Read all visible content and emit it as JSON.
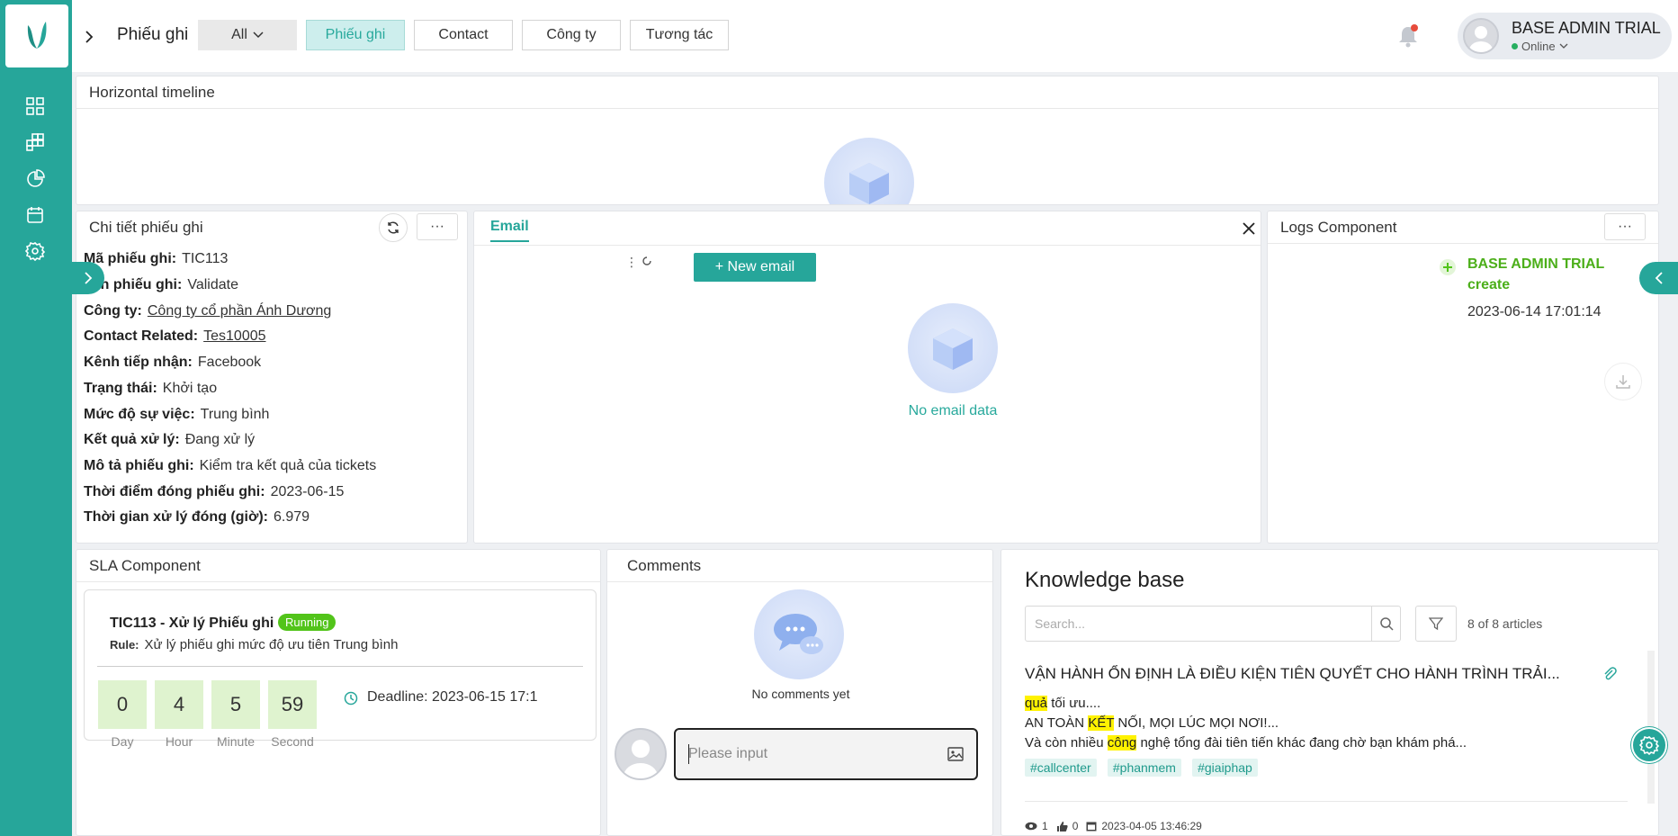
{
  "topbar": {
    "title": "Phiếu ghi",
    "filter_all": "All",
    "tabs": [
      "Phiếu ghi",
      "Contact",
      "Công ty",
      "Tương tác"
    ],
    "user_name": "BASE ADMIN TRIAL",
    "user_status": "Online"
  },
  "timeline": {
    "title": "Horizontal timeline"
  },
  "detail": {
    "title": "Chi tiết phiếu ghi",
    "fields": [
      {
        "label": "Mã phiếu ghi:",
        "value": "TIC113"
      },
      {
        "label": "Tên phiếu ghi:",
        "value": "Validate"
      },
      {
        "label": "Công ty:",
        "value": "Công ty cổ phần Ánh Dương"
      },
      {
        "label": "Contact Related:",
        "value": "Tes10005"
      },
      {
        "label": "Kênh tiếp nhận:",
        "value": "Facebook"
      },
      {
        "label": "Trạng thái:",
        "value": "Khởi tạo"
      },
      {
        "label": "Mức độ sự việc:",
        "value": "Trung bình"
      },
      {
        "label": "Kết quả xử lý:",
        "value": "Đang xử lý"
      },
      {
        "label": "Mô tả phiếu ghi:",
        "value": "Kiểm tra kết quả của tickets"
      },
      {
        "label": "Thời điểm đóng phiếu ghi:",
        "value": "2023-06-15"
      },
      {
        "label": "Thời gian xử lý đóng (giờ):",
        "value": "6.979"
      }
    ],
    "more_label": "···"
  },
  "email": {
    "tab": "Email",
    "new_button": "+ New email",
    "empty": "No email data"
  },
  "logs": {
    "title": "Logs Component",
    "more_label": "···",
    "user": "BASE ADMIN TRIAL",
    "action": "create",
    "time": "2023-06-14 17:01:14"
  },
  "sla": {
    "title": "SLA Component",
    "ticket": "TIC113 - Xử lý Phiếu ghi",
    "badge": "Running",
    "rule_label": "Rule:",
    "rule_value": "Xử lý phiếu ghi mức độ ưu tiên Trung bình",
    "counts": [
      {
        "value": "0",
        "label": "Day"
      },
      {
        "value": "4",
        "label": "Hour"
      },
      {
        "value": "5",
        "label": "Minute"
      },
      {
        "value": "59",
        "label": "Second"
      }
    ],
    "deadline": "Deadline: 2023-06-15 17:1"
  },
  "comments": {
    "title": "Comments",
    "empty": "No comments yet",
    "placeholder": "Please input"
  },
  "kb": {
    "title": "Knowledge base",
    "search_placeholder": "Search...",
    "count": "8 of 8 articles",
    "article_title": "VẬN HÀNH ỔN ĐỊNH LÀ ĐIỀU KIỆN TIÊN QUYẾT CHO HÀNH TRÌNH TRẢI...",
    "line1_hl": "quả",
    "line1_rest": " tối ưu....",
    "line2_a": "AN TOÀN ",
    "line2_hl": "KẾT",
    "line2_b": " NỐI, MỌI LÚC MỌI NƠI!...",
    "line3_a": "Và còn nhiều ",
    "line3_hl": "công",
    "line3_b": " nghệ tổng đài tiên tiến khác đang chờ bạn khám phá...",
    "tags": [
      "#callcenter",
      "#phanmem",
      "#giaiphap"
    ],
    "views": "1",
    "likes": "0",
    "date": "2023-04-05 13:46:29"
  },
  "colors": {
    "brand": "#26a69a",
    "accent_text": "#28a99c",
    "running": "#52c41a"
  }
}
